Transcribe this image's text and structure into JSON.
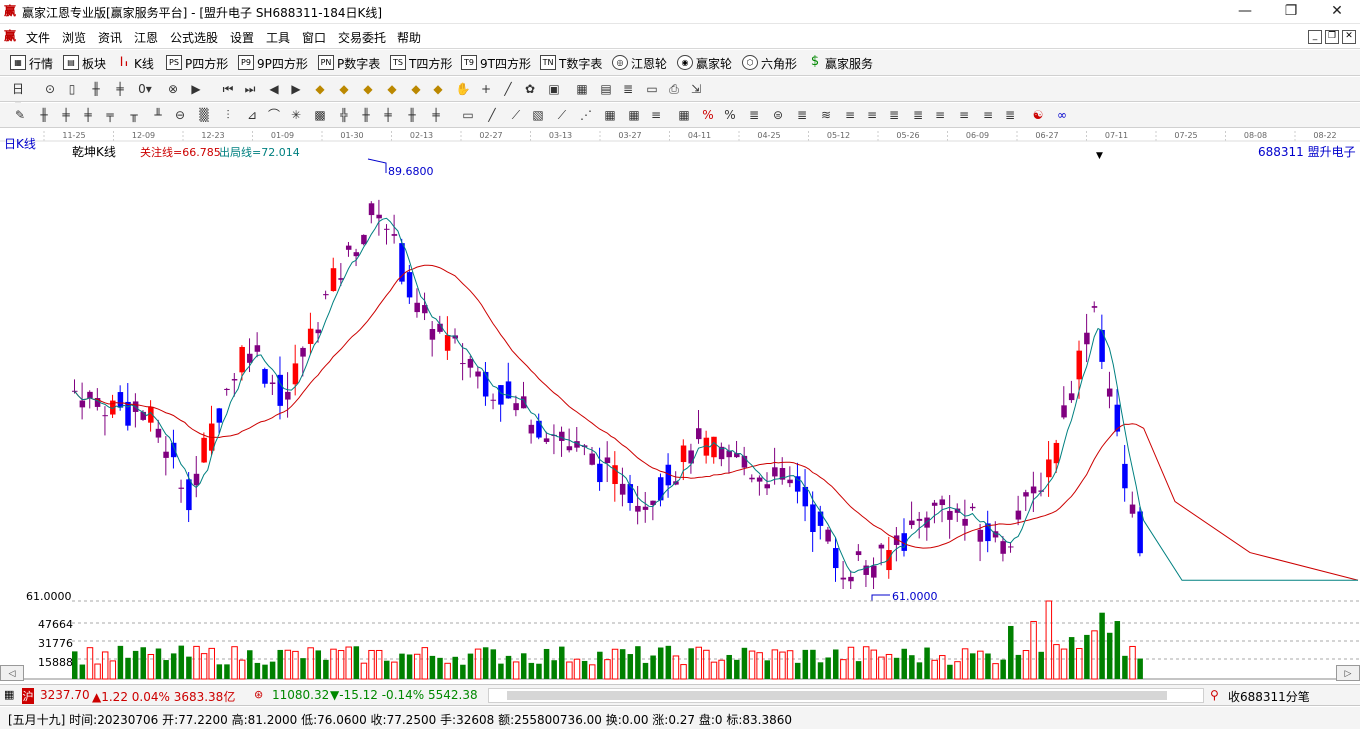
{
  "window": {
    "title": "赢家江恩专业版[赢家服务平台] - [盟升电子  SH688311-184日K线]",
    "minimize": "—",
    "maximize": "❐",
    "close": "✕"
  },
  "menu": [
    "文件",
    "浏览",
    "资讯",
    "江恩",
    "公式选股",
    "设置",
    "工具",
    "窗口",
    "交易委托",
    "帮助"
  ],
  "nav": [
    {
      "label": "行情",
      "icon": "table-icon"
    },
    {
      "label": "板块",
      "icon": "grid-icon"
    },
    {
      "label": "K线",
      "icon": "candlestick-icon"
    },
    {
      "label": "P四方形",
      "icon": "ps-box-icon",
      "badge": "PS"
    },
    {
      "label": "9P四方形",
      "icon": "p9-box-icon",
      "badge": "P9"
    },
    {
      "label": "P数字表",
      "icon": "pn-box-icon",
      "badge": "PN"
    },
    {
      "label": "T四方形",
      "icon": "ts-box-icon",
      "badge": "TS"
    },
    {
      "label": "9T四方形",
      "icon": "t9-box-icon",
      "badge": "T9"
    },
    {
      "label": "T数字表",
      "icon": "tn-box-icon",
      "badge": "TN"
    },
    {
      "label": "江恩轮",
      "icon": "wheel-icon"
    },
    {
      "label": "赢家轮",
      "icon": "wheel2-icon"
    },
    {
      "label": "六角形",
      "icon": "hexagon-icon"
    },
    {
      "label": "赢家服务",
      "icon": "dollar-icon"
    }
  ],
  "chart": {
    "period_label": "日K线",
    "indicator_name": "乾坤K线",
    "focus_line": "关注线=66.785",
    "exit_line": "出局线=72.014",
    "stock_label": "688311  盟升电子",
    "high_label": "89.6800",
    "low_label": "61.0000",
    "volume_axis": [
      "61.0000",
      "47664",
      "31776",
      "15888"
    ],
    "date_ticks": [
      "11-25",
      "12-09",
      "12-23",
      "01-09",
      "01-30",
      "02-13",
      "02-27",
      "03-13",
      "03-27",
      "04-11",
      "04-25",
      "05-12",
      "05-26",
      "06-09",
      "06-27",
      "07-11",
      "07-25",
      "08-08",
      "08-22"
    ],
    "colors": {
      "up": "#ff0000",
      "down": "#0000ff",
      "mid": "#800080",
      "ma_slow": "#cc0000",
      "ma_fast": "#008080",
      "vol_up": "#ff0000",
      "vol_down": "#008000"
    }
  },
  "chart_data": {
    "type": "candlestick",
    "price_range": [
      61.0,
      89.68
    ],
    "ohlc_sample": [
      {
        "o": 75.0,
        "h": 77.0,
        "l": 73.5,
        "c": 74.2
      },
      {
        "o": 74.0,
        "h": 75.5,
        "l": 72.0,
        "c": 72.8
      },
      {
        "o": 72.5,
        "h": 74.0,
        "l": 70.0,
        "c": 71.0
      },
      {
        "o": 71.0,
        "h": 73.0,
        "l": 69.5,
        "c": 72.5
      },
      {
        "o": 72.5,
        "h": 78.0,
        "l": 72.0,
        "c": 77.5
      },
      {
        "o": 77.5,
        "h": 80.5,
        "l": 76.5,
        "c": 79.8
      },
      {
        "o": 79.8,
        "h": 85.0,
        "l": 79.0,
        "c": 84.0
      },
      {
        "o": 84.0,
        "h": 89.68,
        "l": 83.0,
        "c": 86.5
      },
      {
        "o": 86.5,
        "h": 87.0,
        "l": 80.0,
        "c": 81.0
      },
      {
        "o": 81.0,
        "h": 82.5,
        "l": 76.0,
        "c": 77.0
      },
      {
        "o": 77.0,
        "h": 78.0,
        "l": 72.0,
        "c": 73.0
      },
      {
        "o": 73.0,
        "h": 74.5,
        "l": 68.5,
        "c": 69.5
      },
      {
        "o": 69.5,
        "h": 76.0,
        "l": 69.0,
        "c": 74.0
      },
      {
        "o": 74.0,
        "h": 75.0,
        "l": 67.5,
        "c": 68.5
      },
      {
        "o": 68.5,
        "h": 69.0,
        "l": 61.0,
        "c": 63.0
      },
      {
        "o": 63.0,
        "h": 68.0,
        "l": 62.5,
        "c": 66.5
      },
      {
        "o": 66.5,
        "h": 67.5,
        "l": 62.0,
        "c": 63.5
      },
      {
        "o": 63.5,
        "h": 70.5,
        "l": 63.0,
        "c": 69.8
      },
      {
        "o": 69.8,
        "h": 82.0,
        "l": 69.0,
        "c": 78.0
      },
      {
        "o": 78.0,
        "h": 79.0,
        "l": 63.5,
        "c": 64.2
      }
    ],
    "volume_levels": [
      15888,
      31776,
      47664
    ]
  },
  "status": {
    "sh_index": "3237.70",
    "sh_change": "▲1.22 0.04% 3683.38亿",
    "sz_index": "11080.32",
    "sz_change": "▼-15.12 -0.14% 5542.38",
    "tick_label": "收688311分笔"
  },
  "info": {
    "text": "[五月十九] 时间:20230706 开:77.2200 高:81.2000 低:76.0600 收:77.2500 手:32608 额:255800736.00 换:0.00 涨:0.27 盘:0 标:83.3860"
  }
}
